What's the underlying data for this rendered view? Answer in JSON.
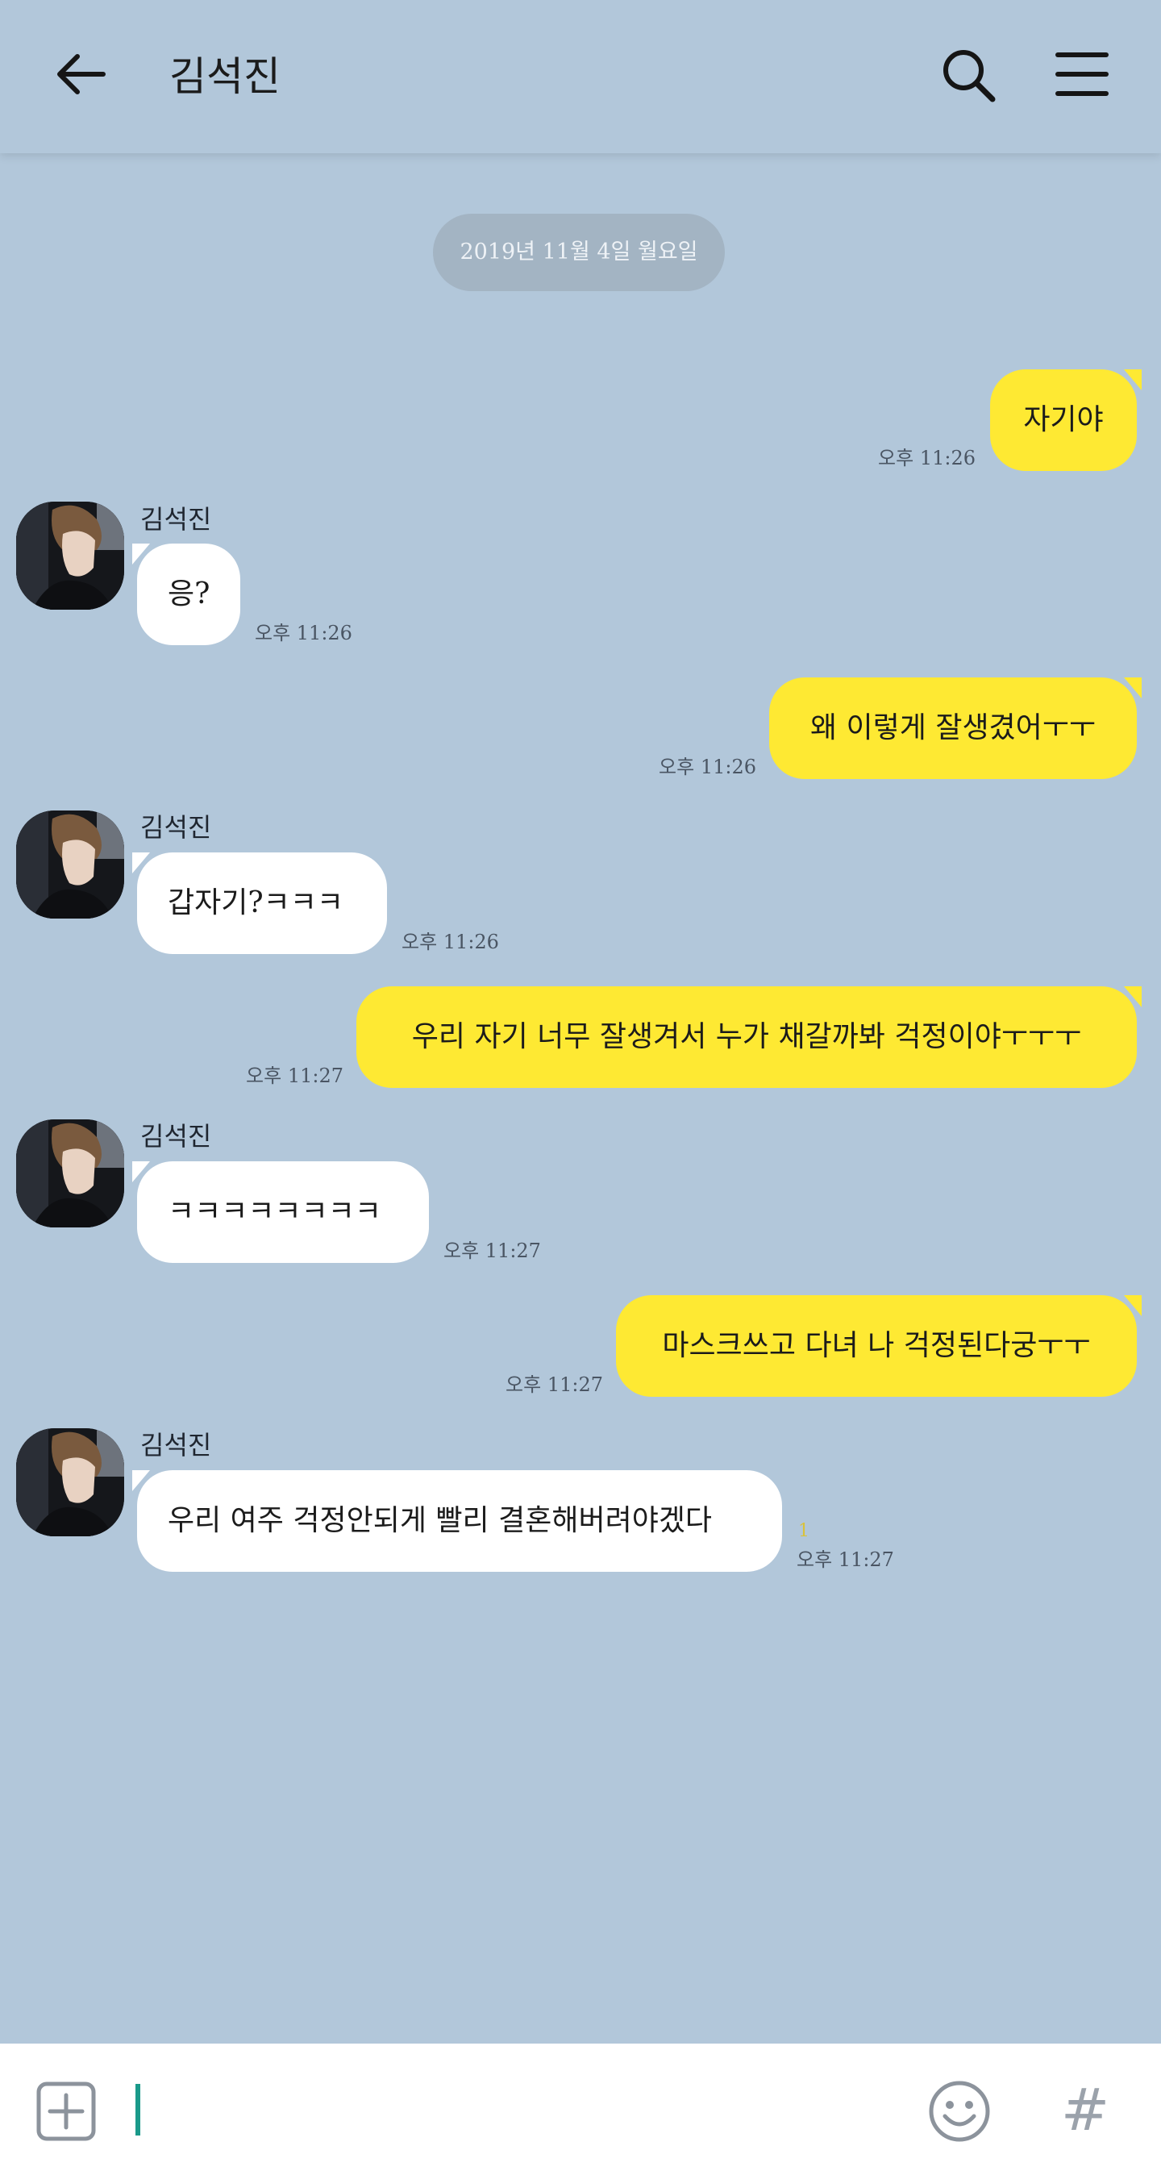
{
  "header": {
    "title": "김석진",
    "back_icon": "arrow-left-icon",
    "search_icon": "search-icon",
    "menu_icon": "hamburger-menu-icon"
  },
  "date_divider": "2019년 11월 4일 월요일",
  "messages": [
    {
      "from": "me",
      "text": "자기야",
      "time": "오후 11:26"
    },
    {
      "from": "other",
      "sender": "김석진",
      "text": "응?",
      "time": "오후 11:26"
    },
    {
      "from": "me",
      "text": "왜 이렇게 잘생겼어ㅜㅜ",
      "time": "오후 11:26"
    },
    {
      "from": "other",
      "sender": "김석진",
      "text": "갑자기?ㅋㅋㅋ",
      "time": "오후 11:26"
    },
    {
      "from": "me",
      "text": "우리 자기 너무 잘생겨서 누가 채갈까봐 걱정이야ㅜㅜㅜ",
      "time": "오후 11:27"
    },
    {
      "from": "other",
      "sender": "김석진",
      "text": "ㅋㅋㅋㅋㅋㅋㅋㅋ",
      "time": "오후 11:27"
    },
    {
      "from": "me",
      "text": "마스크쓰고 다녀 나 걱정된다궁ㅜㅜ",
      "time": "오후 11:27"
    },
    {
      "from": "other",
      "sender": "김석진",
      "text": "우리 여주 걱정안되게 빨리 결혼해버려야겠다",
      "time": "오후 11:27",
      "unread": "1"
    }
  ],
  "input_bar": {
    "placeholder": "",
    "plus_icon": "plus-square-icon",
    "emoji_icon": "smiley-icon",
    "hash_label": "#"
  },
  "colors": {
    "background": "#b2c7da",
    "my_bubble": "#fee933",
    "other_bubble": "#ffffff",
    "date_pill": "#a3b4c3",
    "cursor": "#1a9a8a"
  }
}
